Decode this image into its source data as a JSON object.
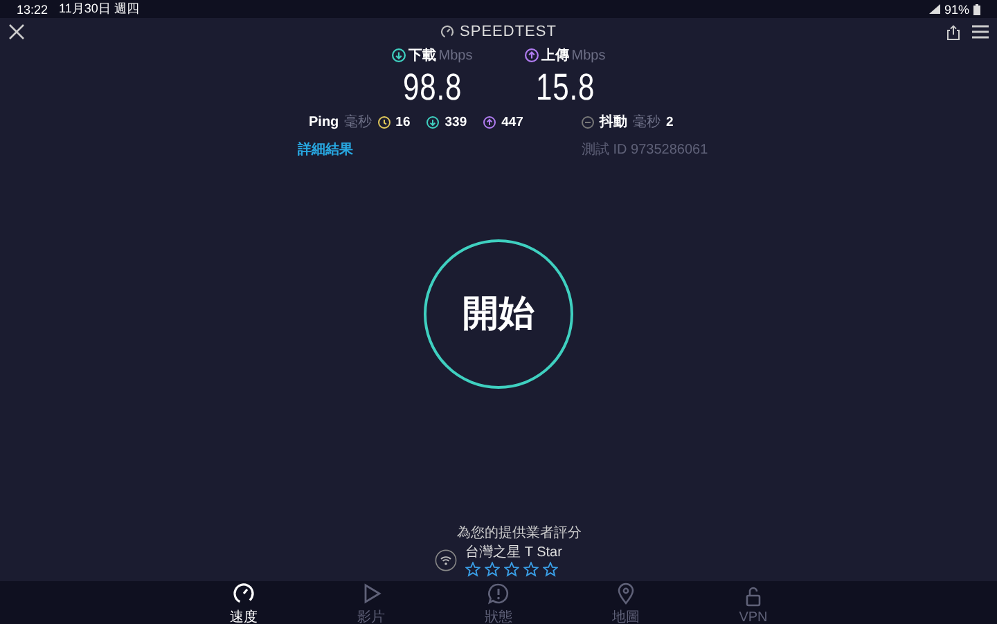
{
  "status_bar": {
    "time": "13:22",
    "date": "11月30日 週四",
    "battery": "91%"
  },
  "header": {
    "logo": "SPEEDTEST"
  },
  "results": [
    {
      "kind": "download",
      "label": "下載",
      "unit": "Mbps",
      "value": "98.8"
    },
    {
      "kind": "upload",
      "label": "上傳",
      "unit": "Mbps",
      "value": "15.8"
    }
  ],
  "ping": {
    "label": "Ping",
    "unit": "毫秒",
    "idle": "16",
    "download": "339",
    "upload": "447"
  },
  "jitter": {
    "label": "抖動",
    "unit": "毫秒",
    "value": "2"
  },
  "details_link": "詳細結果",
  "test_id": "測試 ID 9735286061",
  "start_button": "開始",
  "rating": {
    "prompt": "為您的提供業者評分",
    "provider": "台灣之星 T Star",
    "stars": 0
  },
  "nav": [
    {
      "kind": "speed",
      "label": "速度",
      "selected": true
    },
    {
      "kind": "video",
      "label": "影片",
      "selected": false
    },
    {
      "kind": "status",
      "label": "狀態",
      "selected": false
    },
    {
      "kind": "map",
      "label": "地圖",
      "selected": false
    },
    {
      "kind": "vpn",
      "label": "VPN",
      "selected": false
    }
  ]
}
